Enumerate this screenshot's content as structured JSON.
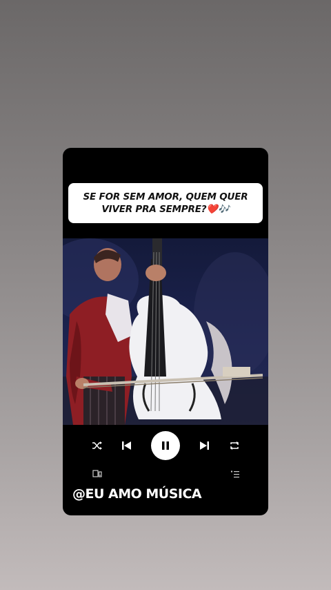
{
  "caption": {
    "line1": "SE FOR SEM AMOR, QUEM QUER",
    "line2": "VIVER PRA SEMPRE?❤️🎶"
  },
  "artwork": {
    "subject": "musician-playing-white-double-bass"
  },
  "player": {
    "is_playing": true,
    "controls": [
      "shuffle-icon",
      "previous-icon",
      "pause-icon",
      "next-icon",
      "repeat-icon"
    ],
    "secondary": [
      "connect-device-icon",
      "queue-icon"
    ]
  },
  "watermark": "@EU AMO MÚSICA",
  "colors": {
    "card": "#000000",
    "caption_bg": "#ffffff",
    "accent": "#ffffff"
  }
}
